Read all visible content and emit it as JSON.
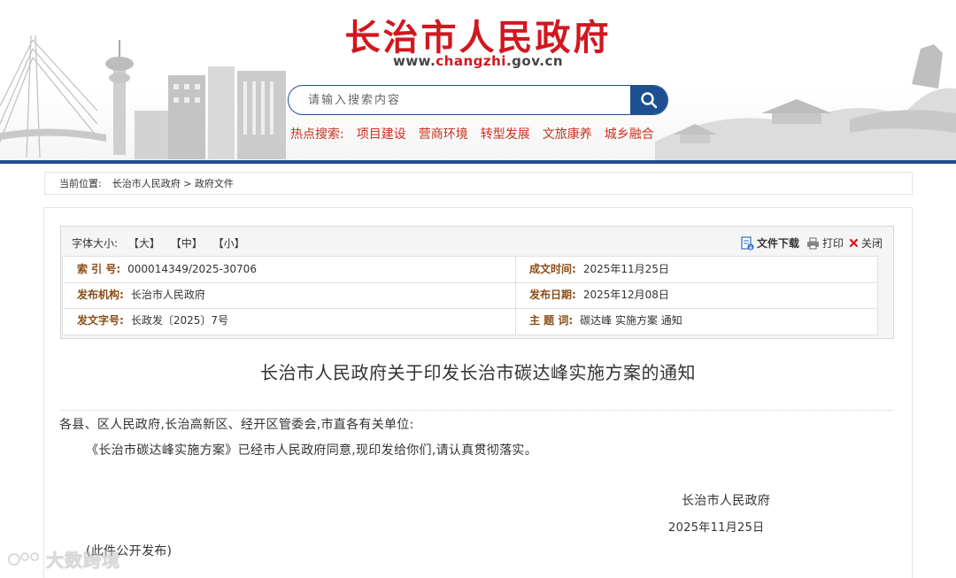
{
  "header": {
    "site_title": "长治市人民政府",
    "url_prefix": "www.",
    "url_highlight": "changzhi",
    "url_suffix": ".gov.cn",
    "search_placeholder": "请输入搜索内容",
    "hot_label": "热点搜索:",
    "hot_items": [
      "项目建设",
      "营商环境",
      "转型发展",
      "文旅康养",
      "城乡融合"
    ],
    "colors": {
      "brand_red": "#d2171f",
      "brand_blue": "#1d4f91",
      "hot_text": "#c9321f"
    }
  },
  "breadcrumb": {
    "label": "当前位置:",
    "path": "长治市人民政府 > 政府文件"
  },
  "toolbar": {
    "font_size_label": "字体大小:",
    "font_large": "【大】",
    "font_medium": "【中】",
    "font_small": "【小】",
    "download": "文件下载",
    "print": "打印",
    "close": "关闭"
  },
  "meta": {
    "index_label": "索 引 号:",
    "index_value": "000014349/2025-30706",
    "created_label": "成文时间:",
    "created_value": "2025年11月25日",
    "issuer_label": "发布机构:",
    "issuer_value": "长治市人民政府",
    "published_label": "发布日期:",
    "published_value": "2025年12月08日",
    "doc_no_label": "发文字号:",
    "doc_no_value": "长政发〔2025〕7号",
    "subject_label": "主 题 词:",
    "subject_value": "碳达峰 实施方案 通知"
  },
  "document": {
    "title": "长治市人民政府关于印发长治市碳达峰实施方案的通知",
    "salutation": "各县、区人民政府,长治高新区、经开区管委会,市直各有关单位:",
    "paragraph": "《长治市碳达峰实施方案》已经市人民政府同意,现印发给你们,请认真贯彻落实。",
    "signer": "长治市人民政府",
    "date": "2025年11月25日",
    "note": "(此件公开发布)"
  },
  "watermark": {
    "text": "大数跨境"
  }
}
